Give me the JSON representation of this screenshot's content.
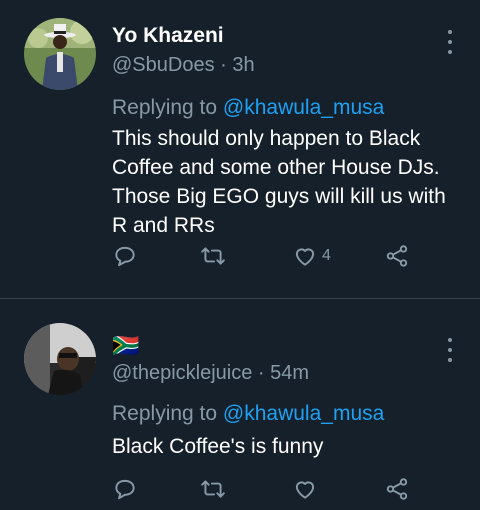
{
  "tweets": [
    {
      "display_name": "Yo Khazeni",
      "handle": "@SbuDoes",
      "separator": " · ",
      "time": "3h",
      "replying_prefix": "Replying to ",
      "replying_to": "@khawula_musa",
      "text": "This should only happen to Black Coffee and some other House DJs. Those Big EGO guys will kill us with R and RRs",
      "like_count": "4"
    },
    {
      "display_name_flag": "🇿🇦",
      "handle": "@thepicklejuice",
      "separator": " · ",
      "time": "54m",
      "replying_prefix": "Replying to ",
      "replying_to": "@khawula_musa",
      "text": "Black Coffee's is funny",
      "like_count": ""
    }
  ],
  "colors": {
    "background": "#15202b",
    "secondary_text": "#8899a6",
    "mention": "#1da1f2",
    "divider": "#38444d"
  },
  "icons": [
    "reply-icon",
    "retweet-icon",
    "like-icon",
    "share-icon",
    "more-icon"
  ]
}
